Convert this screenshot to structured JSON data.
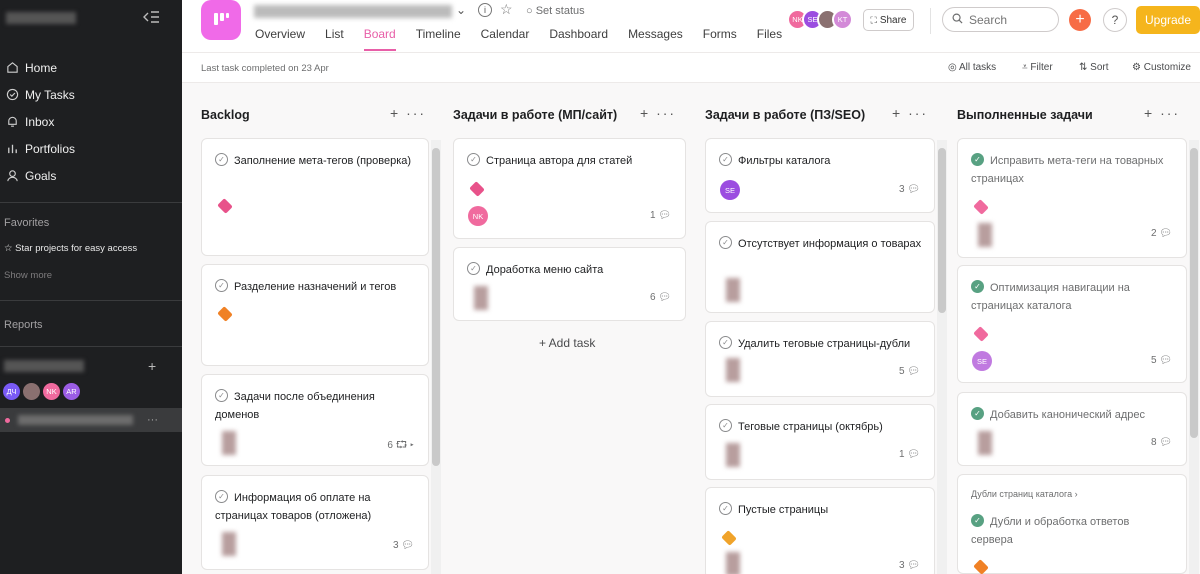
{
  "sidebar": {
    "collapse_icon": "sidebar-collapse-icon",
    "nav": [
      {
        "label": "Home",
        "icon": "home-icon"
      },
      {
        "label": "My Tasks",
        "icon": "check-circle-icon"
      },
      {
        "label": "Inbox",
        "icon": "bell-icon"
      },
      {
        "label": "Portfolios",
        "icon": "bar-chart-icon"
      },
      {
        "label": "Goals",
        "icon": "person-icon"
      }
    ],
    "favorites_title": "Favorites",
    "favorites_hint": "☆ Star projects for easy access",
    "show_more": "Show more",
    "reports_title": "Reports",
    "team_avatars": [
      {
        "initials": "ДЧ",
        "color": "#7a5af5"
      },
      {
        "initials": "",
        "color": "#8a7070"
      },
      {
        "initials": "NK",
        "color": "#f06a9e"
      },
      {
        "initials": "AR",
        "color": "#9b5de5"
      }
    ],
    "project_more": "···"
  },
  "header": {
    "set_status": "Set status",
    "tabs": [
      "Overview",
      "List",
      "Board",
      "Timeline",
      "Calendar",
      "Dashboard",
      "Messages",
      "Forms",
      "Files"
    ],
    "active_tab": "Board",
    "member_avatars": [
      {
        "initials": "NK",
        "color": "#f06a9e"
      },
      {
        "initials": "SE",
        "color": "#9b4de0"
      },
      {
        "initials": "",
        "color": "#8a7070"
      },
      {
        "initials": "KT",
        "color": "#d38ad8"
      }
    ],
    "share_label": "Share",
    "search_placeholder": "Search",
    "upgrade_label": "Upgrade",
    "help_label": "?"
  },
  "toolbar": {
    "last_completed": "Last task completed on 23 Apr",
    "all_tasks": "All tasks",
    "filter": "Filter",
    "sort": "Sort",
    "customize": "Customize"
  },
  "board": {
    "add_task": "+ Add task",
    "columns": [
      {
        "name": "Backlog",
        "cards": [
          {
            "title": "Заполнение мета-тегов (проверка)",
            "tag_color": "#e8528a",
            "comments": ""
          },
          {
            "title": "Разделение назначений и тегов",
            "tag_color": "#f08125",
            "comments": ""
          },
          {
            "title": "Задачи после объединения доменов",
            "comments": "6 ⮔ ▸"
          },
          {
            "title": "Информация об оплате на страницах товаров (отложена)",
            "comments": "3"
          }
        ]
      },
      {
        "name": "Задачи в работе (МП/сайт)",
        "cards": [
          {
            "title": "Страница автора для статей",
            "tag_color": "#e8528a",
            "assignee": {
              "initials": "NK",
              "color": "#f06a9e"
            },
            "comments": "1"
          },
          {
            "title": "Доработка меню сайта",
            "comments": "6"
          }
        ]
      },
      {
        "name": "Задачи в работе (ПЗ/SEO)",
        "cards": [
          {
            "title": "Фильтры каталога",
            "assignee": {
              "initials": "SE",
              "color": "#9b4de0"
            },
            "comments": "3"
          },
          {
            "title": "Отсутствует информация о товарах",
            "comments": ""
          },
          {
            "title": "Удалить теговые страницы-дубли",
            "comments": "5"
          },
          {
            "title": "Теговые страницы (октябрь)",
            "comments": "1"
          },
          {
            "title": "Пустые страницы",
            "tag_color": "#f0a32a",
            "comments": "3"
          }
        ]
      },
      {
        "name": "Выполненные задачи",
        "cards": [
          {
            "title": "Исправить мета-теги на товарных страницах",
            "tag_color": "#f06a9e",
            "comments": "2"
          },
          {
            "title": "Оптимизация навигации на страницах каталога",
            "tag_color": "#f06a9e",
            "assignee": {
              "initials": "SE",
              "color": "#c07ae0"
            },
            "comments": "5"
          },
          {
            "title": "Добавить канонический адрес",
            "comments": "8"
          },
          {
            "title": "Дубли и обработка ответов сервера",
            "tag_color": "#f08125",
            "comments": ""
          }
        ],
        "subsection": "Дубли страниц каталога ›"
      }
    ]
  },
  "colors": {
    "accent": "#e85fa8",
    "upgrade": "#f5b51c",
    "sidebar_bg": "#1e1f21",
    "done_check": "#58a182"
  }
}
